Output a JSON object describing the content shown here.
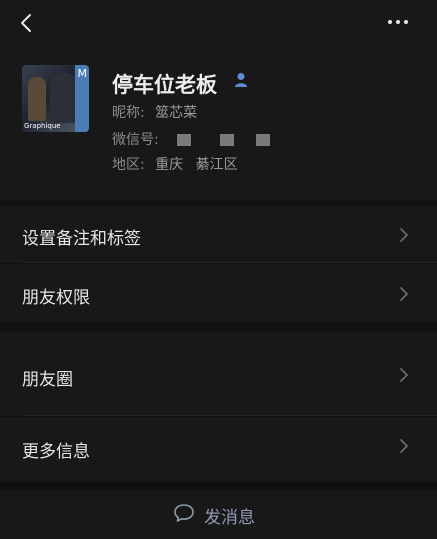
{
  "header": {
    "back_icon": "chevron-left-icon",
    "more_icon": "more-dots-icon"
  },
  "profile": {
    "avatar_caption": "Graphique",
    "avatar_magazine_letter": "M",
    "name": "停车位老板",
    "verified_icon": "person-icon",
    "nickname_label": "昵称:",
    "nickname_value": "筮芯菜",
    "wechat_id_label": "微信号:",
    "region_label": "地区:",
    "region_city": "重庆",
    "region_district": "綦江区"
  },
  "menu": {
    "set_remark_tags": "设置备注和标签",
    "friend_permissions": "朋友权限",
    "moments": "朋友圈",
    "more_info": "更多信息"
  },
  "actions": {
    "send_message": "发消息",
    "send_icon": "chat-bubble-icon"
  },
  "colors": {
    "background": "#111111",
    "card": "#181818",
    "text_primary": "#e6e6e6",
    "text_secondary": "#8a8a8a",
    "accent_link": "#8f9ab3",
    "verified_blue": "#5b8bd6"
  }
}
